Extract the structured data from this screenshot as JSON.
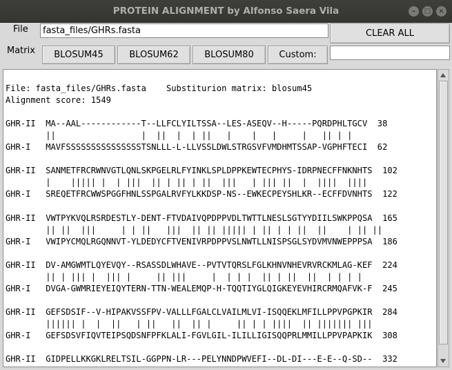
{
  "window": {
    "title": "PROTEIN ALIGNMENT by Alfonso Saera Vila"
  },
  "controls": {
    "file_label": "File",
    "file_value": "fasta_files/GHRs.fasta",
    "clear_all": "CLEAR ALL",
    "matrix_label": "Matrix",
    "blosum45": "BLOSUM45",
    "blosum62": "BLOSUM62",
    "blosum80": "BLOSUM80",
    "custom": "Custom:",
    "custom_value": ""
  },
  "output": {
    "lines": [
      "File: fasta_files/GHRs.fasta    Substiturion matrix: blosum45",
      "Alignment score: 1549",
      "",
      "GHR-II  MA--AAL------------T--LLFCLYILTSSA--LES-ASEQV--H-----PQRDPHLTGCV  38",
      "        ||                 |  ||  |  | ||   |    |   |     |   || | |",
      "GHR-I   MAVFSSSSSSSSSSSSSSSTSNLLL-L-LLVSSLDWLSTRGSVFVMDHMTSSAP-VGPHFTECI  62",
      "",
      "GHR-II  SANMETFRCRWNVGTLQNLSKPGELRLFYINKLSPLDPPKEWTECPHYS-IDRPNECFFNKNHTS  102",
      "        |    ||||| |  | |||  || | || | ||  |||   | ||| ||  |  ||||  ||||",
      "GHR-I   SREQETFRCWWSPGGFHNLSSPGALRVFYLKKDSP-NS--EWKECPEYSHLKR--ECFFDVNHTS  122",
      "",
      "GHR-II  VWTPYKVQLRSRDESTLY-DENT-FTVDAIVQPDPPVDLTWTTLNESLSGTYYDIILSWKPPQSA  165",
      "        || ||  |||     | | ||   |||  || || ||||| | || | | ||  ||    | || ||",
      "GHR-I   VWIPYCMQLRGQNNVT-YLDEDYCFTVENIVRPDPPVSLNWTLLNISPSGLSYDVMVNWEPPPSA  186",
      "",
      "GHR-II  DV-AMGWMTLQYEVQY--RSASSDLWHAVE--PVTVTQRSLFGLKHNVNHEVRVRCKMLAG-KEF  224",
      "        || | ||| |  ||| |     || |||     |  | | |  || | ||  ||  | | | |",
      "GHR-I   DVGA-GWMRIEYEIQYTERN-TTN-WEALEMQP-H-TQQTIYGLQIGKEYEVHIRCRMQAFVK-F  245",
      "",
      "GHR-II  GEFSDSIF--V-HIPAKVSSFPV-VALLLFGALCLVAILMLVI-ISQQEKLMFILLPPVPGPKIR  284",
      "        |||||| |  |  ||   | ||   ||  || |     || | | ||||  || ||||||| |||",
      "GHR-I   GEFSDSVFIQVTEIPSQDSNFPFKLALI-FGVLGIL-ILILLIGISQQPRLMMILLPPVPAPKIK  308",
      "",
      "GHR-II  GIDPELLKKGKLRELTSIL-GGPPN-LR---PELYNNDPWVEFI--DL-DI---E-E--Q-SD--  332"
    ]
  }
}
